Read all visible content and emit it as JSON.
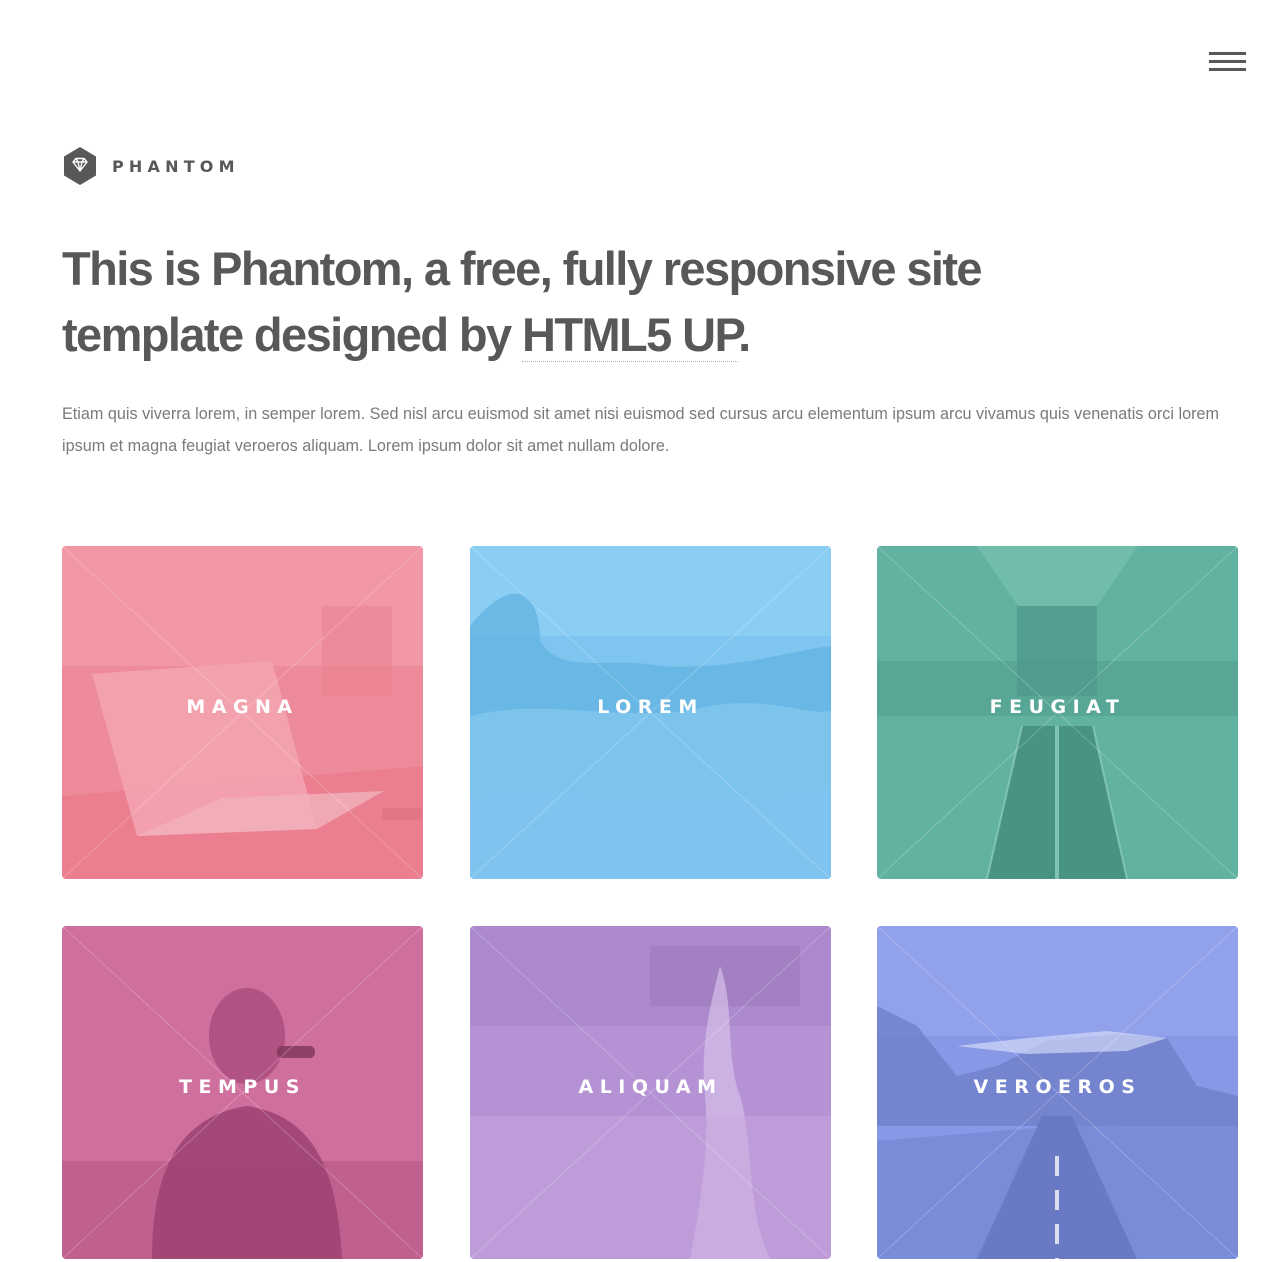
{
  "header": {
    "menu_icon": "hamburger-menu-icon",
    "logo": {
      "icon": "diamond-hexagon-icon",
      "title": "PHANTOM"
    }
  },
  "hero": {
    "headline_text": "This is Phantom, a free, fully responsive site template designed by ",
    "headline_link": "HTML5 UP",
    "headline_end": ".",
    "intro": "Etiam quis viverra lorem, in semper lorem. Sed nisl arcu euismod sit amet nisi euismod sed cursus arcu elementum ipsum arcu vivamus quis venenatis orci lorem ipsum et magna feugiat veroeros aliquam. Lorem ipsum dolor sit amet nullam dolore."
  },
  "tiles": [
    {
      "label": "MAGNA",
      "image": "laptop-on-desk",
      "color": "#f2849e"
    },
    {
      "label": "LOREM",
      "image": "ocean-wave",
      "color": "#7ecaf6"
    },
    {
      "label": "FEUGIAT",
      "image": "escalator-terminal",
      "color": "#5fb2a0"
    },
    {
      "label": "TEMPUS",
      "image": "person-with-sunglasses",
      "color": "#d16fa0"
    },
    {
      "label": "ALIQUAM",
      "image": "frosted-plant",
      "color": "#b38fd5"
    },
    {
      "label": "VEROEROS",
      "image": "mountain-road",
      "color": "#8397e6"
    }
  ]
}
